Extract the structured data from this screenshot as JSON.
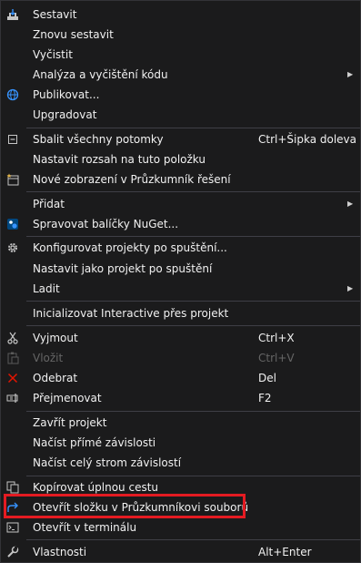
{
  "menu": {
    "items": [
      {
        "label": "Sestavit",
        "icon": "build-icon"
      },
      {
        "label": "Znovu sestavit"
      },
      {
        "label": "Vyčistit"
      },
      {
        "label": "Analýza a vyčištění kódu",
        "submenu": true
      },
      {
        "label": "Publikovat...",
        "icon": "globe-icon"
      },
      {
        "label": "Upgradovat"
      },
      {
        "label": "Sbalit všechny potomky",
        "icon": "collapse-icon",
        "shortcut": "Ctrl+Šipka doleva"
      },
      {
        "label": "Nastavit rozsah na tuto položku"
      },
      {
        "label": "Nové zobrazení v Průzkumník řešení",
        "icon": "new-view-icon"
      },
      {
        "label": "Přidat",
        "submenu": true
      },
      {
        "label": "Spravovat balíčky NuGet...",
        "icon": "nuget-icon"
      },
      {
        "label": "Konfigurovat projekty po spuštění...",
        "icon": "gear-icon"
      },
      {
        "label": "Nastavit jako projekt po spuštění"
      },
      {
        "label": "Ladit",
        "submenu": true
      },
      {
        "label": "Inicializovat Interactive přes projekt"
      },
      {
        "label": "Vyjmout",
        "icon": "scissors-icon",
        "shortcut": "Ctrl+X"
      },
      {
        "label": "Vložit",
        "icon": "paste-icon",
        "shortcut": "Ctrl+V",
        "disabled": true
      },
      {
        "label": "Odebrat",
        "icon": "delete-icon",
        "shortcut": "Del"
      },
      {
        "label": "Přejmenovat",
        "icon": "rename-icon",
        "shortcut": "F2"
      },
      {
        "label": "Zavřít projekt"
      },
      {
        "label": "Načíst přímé závislosti"
      },
      {
        "label": "Načíst celý strom závislostí"
      },
      {
        "label": "Kopírovat úplnou cestu",
        "icon": "copy-icon"
      },
      {
        "label": "Otevřít složku v Průzkumníkovi souborů",
        "icon": "open-folder-arrow-icon",
        "highlighted": true
      },
      {
        "label": "Otevřít v terminálu",
        "icon": "terminal-icon"
      },
      {
        "label": "Vlastnosti",
        "icon": "wrench-icon",
        "shortcut": "Alt+Enter"
      }
    ]
  },
  "colors": {
    "background": "#1b1b1c",
    "text": "#f1f1f1",
    "disabled_text": "#656565",
    "separator": "#3f3f46",
    "highlight_border": "#e41b22",
    "accent_blue": "#3794ff",
    "delete_red": "#e51400"
  }
}
